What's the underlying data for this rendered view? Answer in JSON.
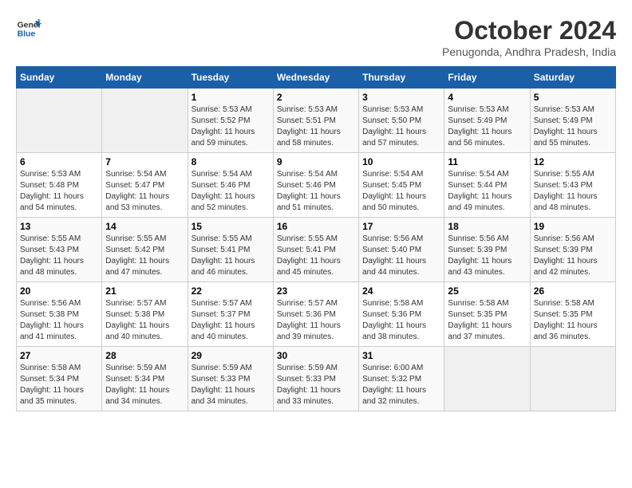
{
  "header": {
    "logo_line1": "General",
    "logo_line2": "Blue",
    "month": "October 2024",
    "location": "Penugonda, Andhra Pradesh, India"
  },
  "weekdays": [
    "Sunday",
    "Monday",
    "Tuesday",
    "Wednesday",
    "Thursday",
    "Friday",
    "Saturday"
  ],
  "weeks": [
    [
      {
        "day": "",
        "empty": true
      },
      {
        "day": "",
        "empty": true
      },
      {
        "day": "1",
        "sunrise": "5:53 AM",
        "sunset": "5:52 PM",
        "daylight": "11 hours and 59 minutes."
      },
      {
        "day": "2",
        "sunrise": "5:53 AM",
        "sunset": "5:51 PM",
        "daylight": "11 hours and 58 minutes."
      },
      {
        "day": "3",
        "sunrise": "5:53 AM",
        "sunset": "5:50 PM",
        "daylight": "11 hours and 57 minutes."
      },
      {
        "day": "4",
        "sunrise": "5:53 AM",
        "sunset": "5:49 PM",
        "daylight": "11 hours and 56 minutes."
      },
      {
        "day": "5",
        "sunrise": "5:53 AM",
        "sunset": "5:49 PM",
        "daylight": "11 hours and 55 minutes."
      }
    ],
    [
      {
        "day": "6",
        "sunrise": "5:53 AM",
        "sunset": "5:48 PM",
        "daylight": "11 hours and 54 minutes."
      },
      {
        "day": "7",
        "sunrise": "5:54 AM",
        "sunset": "5:47 PM",
        "daylight": "11 hours and 53 minutes."
      },
      {
        "day": "8",
        "sunrise": "5:54 AM",
        "sunset": "5:46 PM",
        "daylight": "11 hours and 52 minutes."
      },
      {
        "day": "9",
        "sunrise": "5:54 AM",
        "sunset": "5:46 PM",
        "daylight": "11 hours and 51 minutes."
      },
      {
        "day": "10",
        "sunrise": "5:54 AM",
        "sunset": "5:45 PM",
        "daylight": "11 hours and 50 minutes."
      },
      {
        "day": "11",
        "sunrise": "5:54 AM",
        "sunset": "5:44 PM",
        "daylight": "11 hours and 49 minutes."
      },
      {
        "day": "12",
        "sunrise": "5:55 AM",
        "sunset": "5:43 PM",
        "daylight": "11 hours and 48 minutes."
      }
    ],
    [
      {
        "day": "13",
        "sunrise": "5:55 AM",
        "sunset": "5:43 PM",
        "daylight": "11 hours and 48 minutes."
      },
      {
        "day": "14",
        "sunrise": "5:55 AM",
        "sunset": "5:42 PM",
        "daylight": "11 hours and 47 minutes."
      },
      {
        "day": "15",
        "sunrise": "5:55 AM",
        "sunset": "5:41 PM",
        "daylight": "11 hours and 46 minutes."
      },
      {
        "day": "16",
        "sunrise": "5:55 AM",
        "sunset": "5:41 PM",
        "daylight": "11 hours and 45 minutes."
      },
      {
        "day": "17",
        "sunrise": "5:56 AM",
        "sunset": "5:40 PM",
        "daylight": "11 hours and 44 minutes."
      },
      {
        "day": "18",
        "sunrise": "5:56 AM",
        "sunset": "5:39 PM",
        "daylight": "11 hours and 43 minutes."
      },
      {
        "day": "19",
        "sunrise": "5:56 AM",
        "sunset": "5:39 PM",
        "daylight": "11 hours and 42 minutes."
      }
    ],
    [
      {
        "day": "20",
        "sunrise": "5:56 AM",
        "sunset": "5:38 PM",
        "daylight": "11 hours and 41 minutes."
      },
      {
        "day": "21",
        "sunrise": "5:57 AM",
        "sunset": "5:38 PM",
        "daylight": "11 hours and 40 minutes."
      },
      {
        "day": "22",
        "sunrise": "5:57 AM",
        "sunset": "5:37 PM",
        "daylight": "11 hours and 40 minutes."
      },
      {
        "day": "23",
        "sunrise": "5:57 AM",
        "sunset": "5:36 PM",
        "daylight": "11 hours and 39 minutes."
      },
      {
        "day": "24",
        "sunrise": "5:58 AM",
        "sunset": "5:36 PM",
        "daylight": "11 hours and 38 minutes."
      },
      {
        "day": "25",
        "sunrise": "5:58 AM",
        "sunset": "5:35 PM",
        "daylight": "11 hours and 37 minutes."
      },
      {
        "day": "26",
        "sunrise": "5:58 AM",
        "sunset": "5:35 PM",
        "daylight": "11 hours and 36 minutes."
      }
    ],
    [
      {
        "day": "27",
        "sunrise": "5:58 AM",
        "sunset": "5:34 PM",
        "daylight": "11 hours and 35 minutes."
      },
      {
        "day": "28",
        "sunrise": "5:59 AM",
        "sunset": "5:34 PM",
        "daylight": "11 hours and 34 minutes."
      },
      {
        "day": "29",
        "sunrise": "5:59 AM",
        "sunset": "5:33 PM",
        "daylight": "11 hours and 34 minutes."
      },
      {
        "day": "30",
        "sunrise": "5:59 AM",
        "sunset": "5:33 PM",
        "daylight": "11 hours and 33 minutes."
      },
      {
        "day": "31",
        "sunrise": "6:00 AM",
        "sunset": "5:32 PM",
        "daylight": "11 hours and 32 minutes."
      },
      {
        "day": "",
        "empty": true
      },
      {
        "day": "",
        "empty": true
      }
    ]
  ]
}
